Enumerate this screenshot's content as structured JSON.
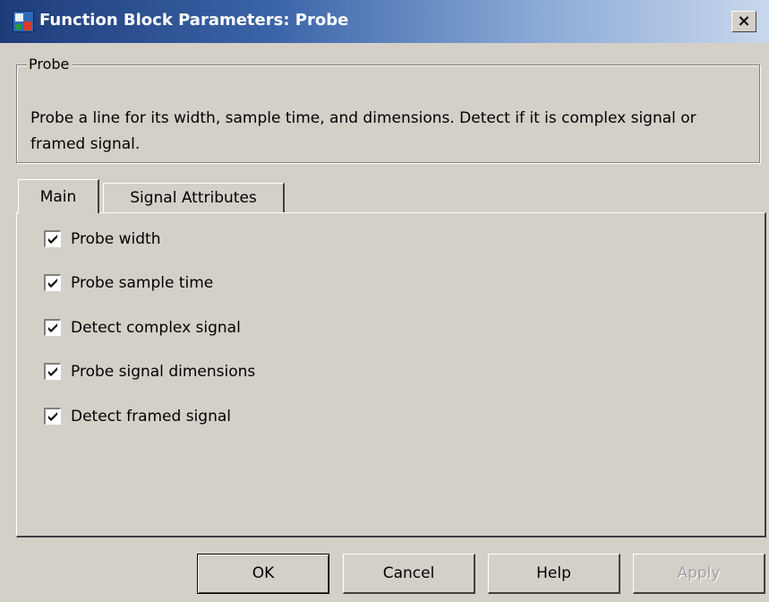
{
  "window": {
    "title": "Function Block Parameters: Probe",
    "close_label": "×"
  },
  "block": {
    "group_label": "Probe",
    "description": "Probe a line for its width, sample time, and dimensions. Detect if it is complex signal or framed signal."
  },
  "tabs": [
    {
      "label": "Main",
      "selected": true
    },
    {
      "label": "Signal Attributes",
      "selected": false
    }
  ],
  "options": [
    {
      "label": "Probe width",
      "checked": true
    },
    {
      "label": "Probe sample time",
      "checked": true
    },
    {
      "label": "Detect complex signal",
      "checked": true
    },
    {
      "label": "Probe signal dimensions",
      "checked": true
    },
    {
      "label": "Detect framed signal",
      "checked": true
    }
  ],
  "buttons": {
    "ok": "OK",
    "cancel": "Cancel",
    "help": "Help",
    "apply": "Apply"
  }
}
